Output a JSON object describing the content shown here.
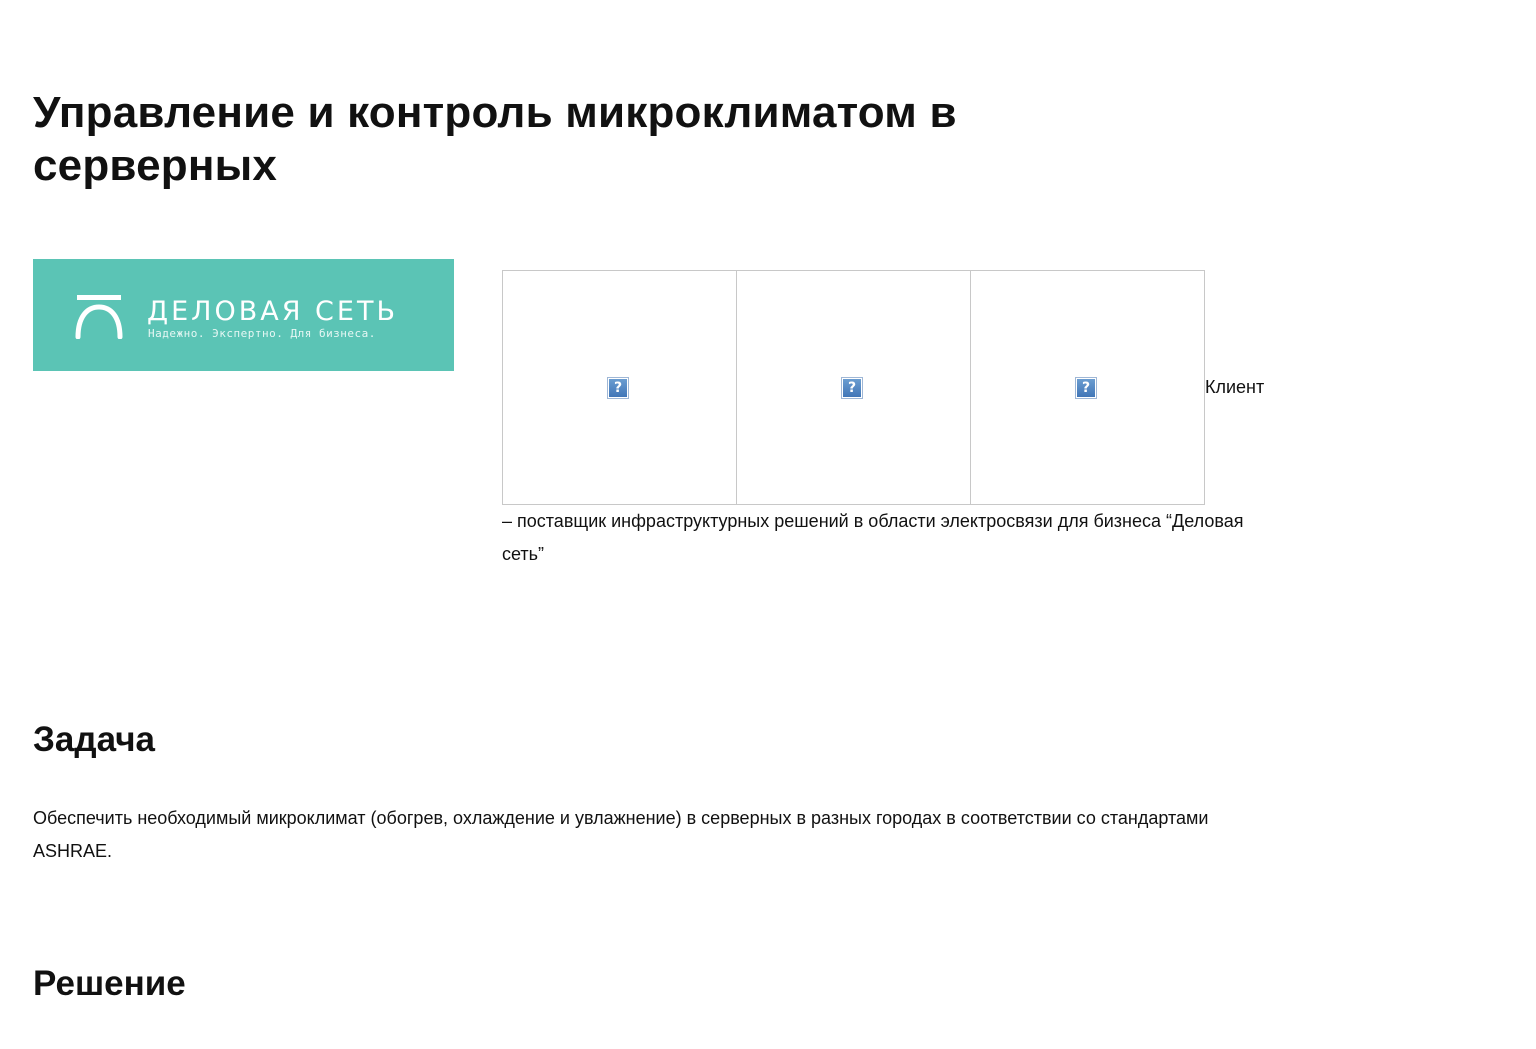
{
  "page": {
    "title": "Управление и контроль микроклиматом в серверных"
  },
  "logo": {
    "name": "ДЕЛОВАЯ СЕТЬ",
    "tagline": "Надежно. Экспертно. Для бизнеса.",
    "background_color": "#5bc4b5",
    "icon": "arc-gate-logo-icon"
  },
  "images": [
    {
      "icon": "broken-image-icon",
      "glyph": "?"
    },
    {
      "icon": "broken-image-icon",
      "glyph": "?"
    },
    {
      "icon": "broken-image-icon",
      "glyph": "?"
    }
  ],
  "client": {
    "label": "Клиент",
    "description": "– поставщик инфраструктурных решений в области электросвязи для бизнеса “Деловая сеть”"
  },
  "task": {
    "heading": "Задача",
    "text": "Обеспечить необходимый микроклимат (обогрев, охлаждение и увлажнение) в серверных в разных городах в соответствии со стандартами ASHRAE."
  },
  "solution": {
    "heading": "Решение"
  }
}
